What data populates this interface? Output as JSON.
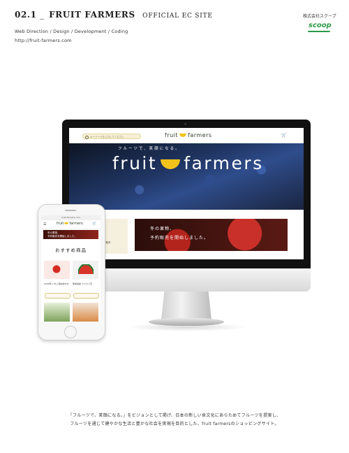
{
  "header": {
    "number": "02.1",
    "separator": "_",
    "project": "FRUIT FARMERS",
    "type": "OFFICIAL EC SITE",
    "roles": "Web Direction / Design / Development / Coding",
    "url": "http://fruit-farmers.com",
    "company": "株式会社スクープ",
    "company_logo": "scoop"
  },
  "desktop_site": {
    "search_placeholder": "キーワードを入力してください",
    "logo_left": "fruit",
    "logo_right": "farmers",
    "cart_icon": "cart-icon",
    "hero_tagline": "フルーツで、笑顔になる。",
    "hero_brand_left": "fruit",
    "hero_brand_right": "farmers",
    "side_item_1": "初めての方へ",
    "side_item_2": "フルーツギフトのご案内",
    "banner_line1": "冬の果物、",
    "banner_line2": "予約販売を開始しました。"
  },
  "mobile_site": {
    "url_bar": "fruit-farmers.com",
    "menu_icon": "menu-icon",
    "logo_left": "fruit",
    "logo_right": "farmers",
    "cart_icon": "cart-icon",
    "hero_line1": "冬の果物、",
    "hero_line2": "予約販売を開始しました。",
    "section_title": "おすすめ商品",
    "product_1": "2020年 いちご詰め合わせ",
    "product_2": "熊本県産 スイカ 1玉"
  },
  "caption": {
    "line1": "「フルーツで、笑顔になる。」をビジョンとして掲げ、日本の新しい食文化にあらためてフルーツを提案し、",
    "line2": "フルーツを通じて健やかな生活と豊かな社会を実現を目的とした、fruit farmersのショッピングサイト。"
  },
  "colors": {
    "brand_yellow": "#f2c21b",
    "scoop_green": "#2c9a49"
  }
}
